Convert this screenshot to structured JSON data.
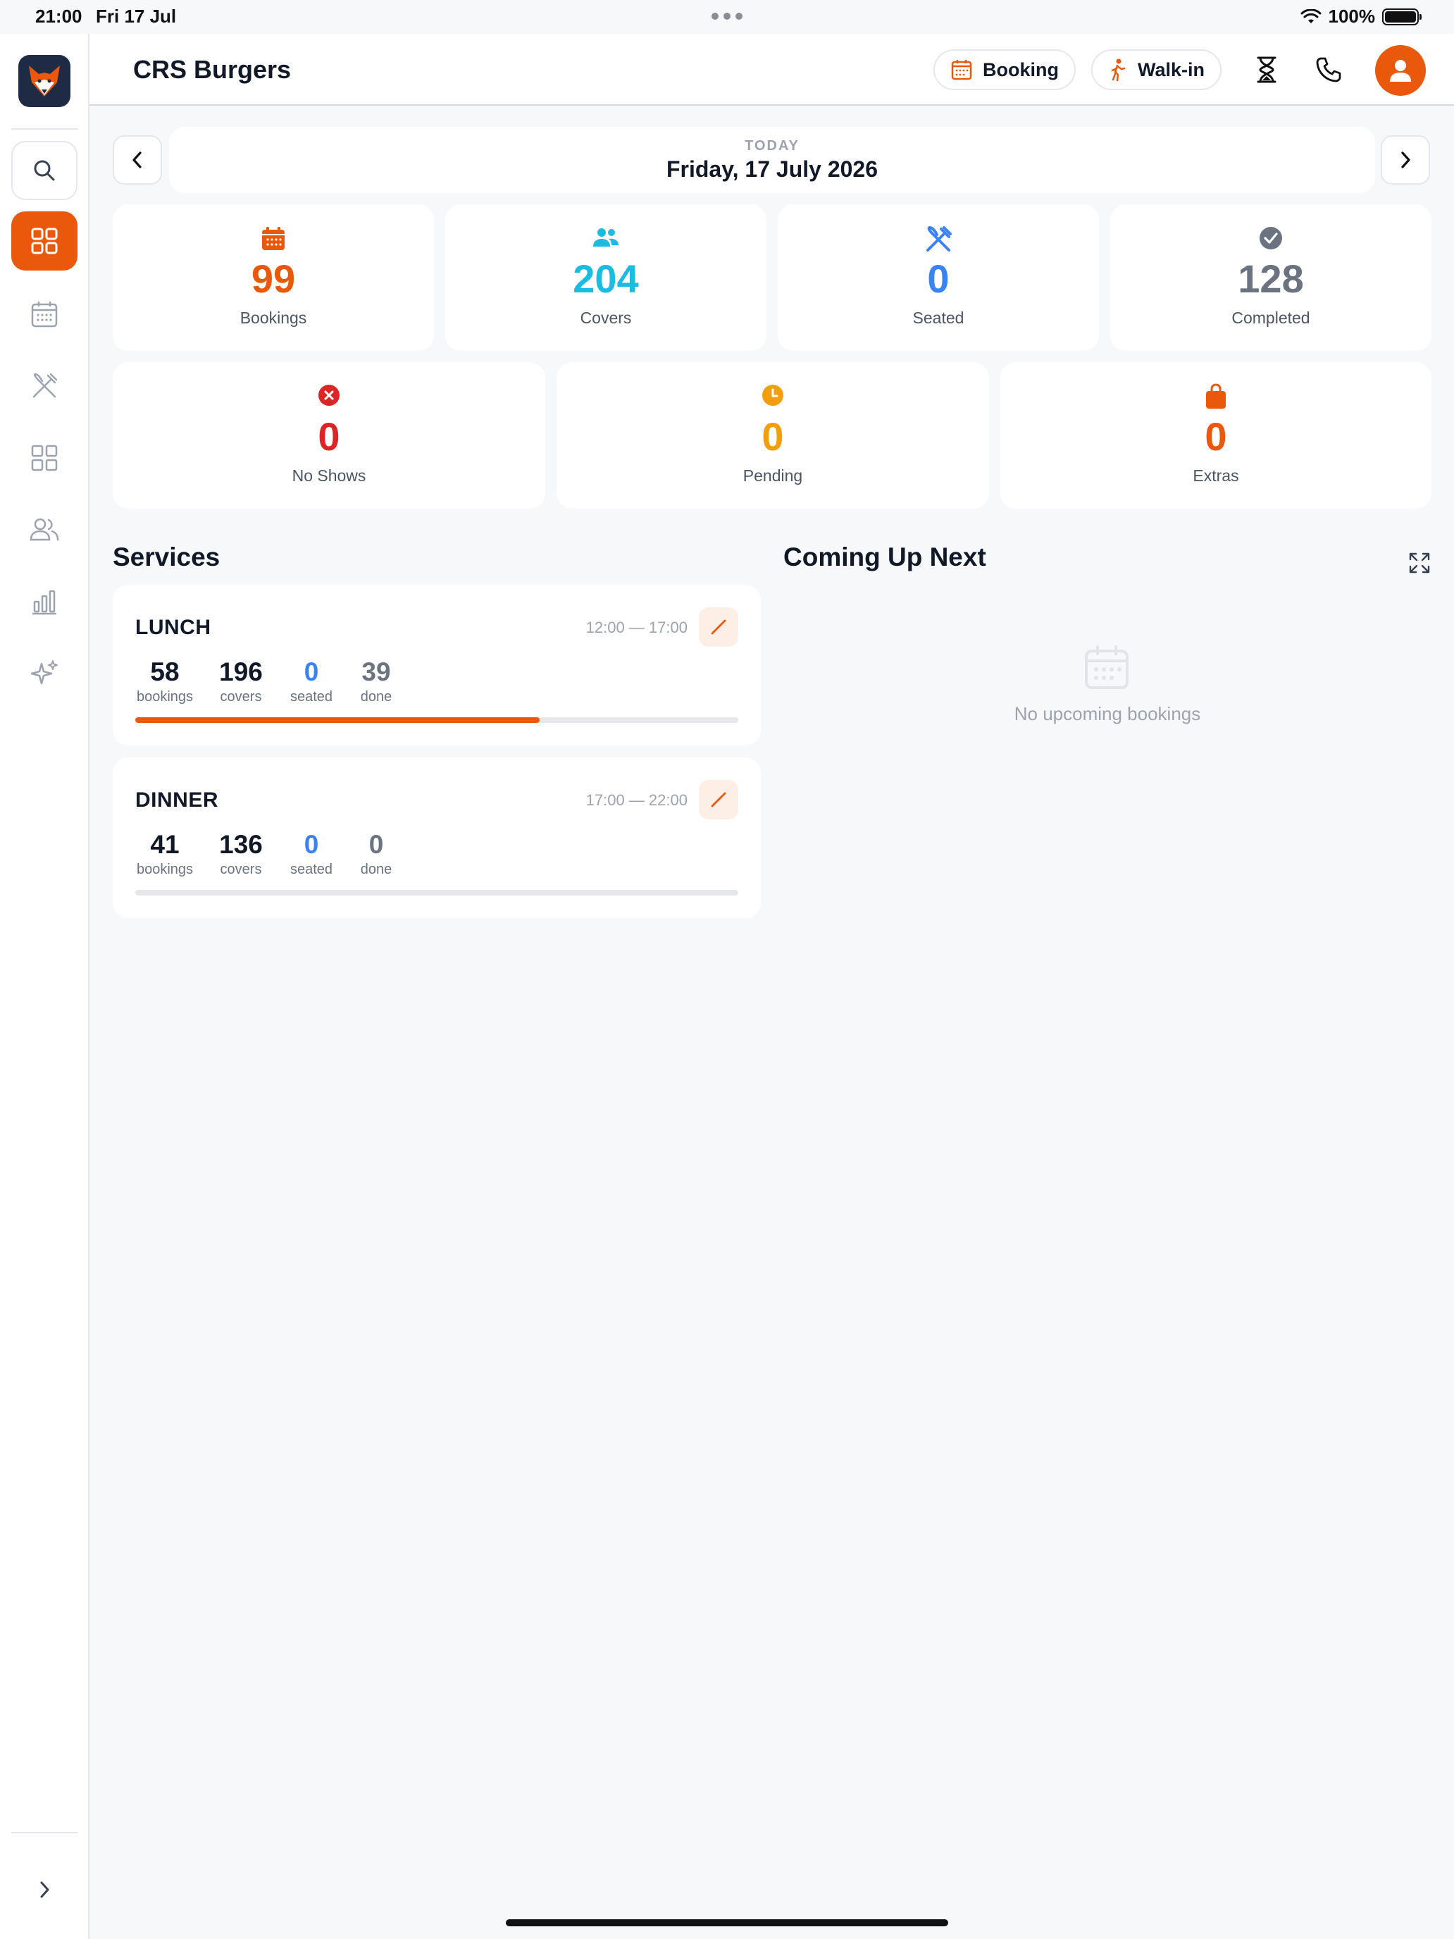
{
  "status_bar": {
    "time": "21:00",
    "date": "Fri 17 Jul",
    "battery": "100%"
  },
  "app": {
    "name": "CRS Burgers"
  },
  "header": {
    "booking_label": "Booking",
    "walkin_label": "Walk-in"
  },
  "sidebar": {
    "items": [
      {
        "name": "search",
        "icon": "search-icon"
      },
      {
        "name": "dashboard",
        "icon": "grid-icon",
        "active": true
      },
      {
        "name": "calendar",
        "icon": "calendar-icon"
      },
      {
        "name": "dining",
        "icon": "utensils-icon"
      },
      {
        "name": "tables",
        "icon": "layout-icon"
      },
      {
        "name": "guests",
        "icon": "users-icon"
      },
      {
        "name": "reports",
        "icon": "bar-chart-icon"
      },
      {
        "name": "ai",
        "icon": "sparkles-icon"
      }
    ],
    "expand_icon": "chevron-right-icon"
  },
  "date_nav": {
    "today_label": "TODAY",
    "date": "Friday, 17 July 2026"
  },
  "stats": {
    "bookings": {
      "value": "99",
      "label": "Bookings",
      "color": "#ea580c"
    },
    "covers": {
      "value": "204",
      "label": "Covers",
      "color": "#1cbbe0"
    },
    "seated": {
      "value": "0",
      "label": "Seated",
      "color": "#3b82f6"
    },
    "completed": {
      "value": "128",
      "label": "Completed",
      "color": "#6b7280"
    },
    "no_shows": {
      "value": "0",
      "label": "No Shows",
      "color": "#dc2626"
    },
    "pending": {
      "value": "0",
      "label": "Pending",
      "color": "#f59e0b"
    },
    "extras": {
      "value": "0",
      "label": "Extras",
      "color": "#ea580c"
    }
  },
  "services": {
    "title": "Services",
    "lunch": {
      "name": "LUNCH",
      "time": "12:00 — 17:00",
      "bookings": "58",
      "bookings_label": "bookings",
      "covers": "196",
      "covers_label": "covers",
      "seated": "0",
      "seated_label": "seated",
      "done": "39",
      "done_label": "done",
      "progress": 0.67
    },
    "dinner": {
      "name": "DINNER",
      "time": "17:00 — 22:00",
      "bookings": "41",
      "bookings_label": "bookings",
      "covers": "136",
      "covers_label": "covers",
      "seated": "0",
      "seated_label": "seated",
      "done": "0",
      "done_label": "done",
      "progress": 0
    }
  },
  "coming_up": {
    "title": "Coming Up Next",
    "empty_text": "No upcoming bookings"
  }
}
